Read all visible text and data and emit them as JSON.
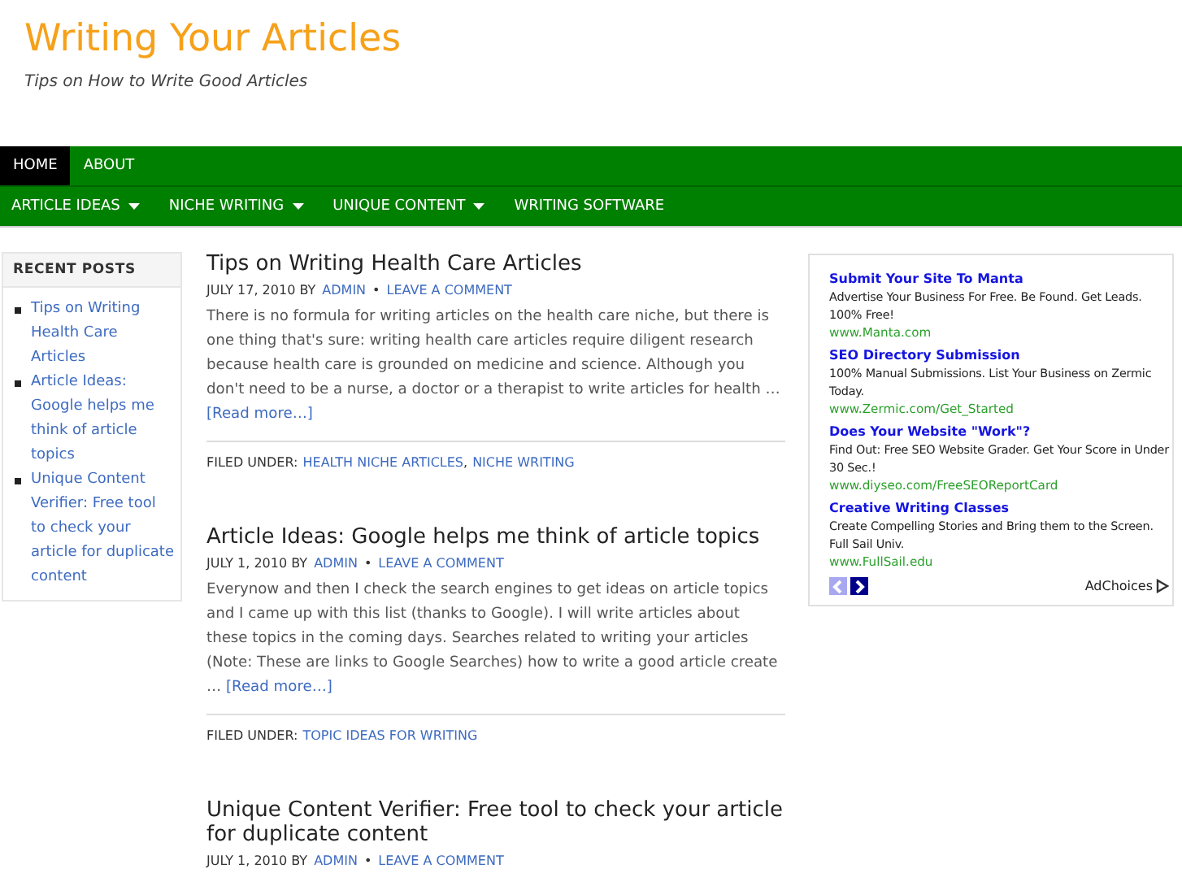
{
  "site": {
    "title": "Writing Your Articles",
    "tagline": "Tips on How to Write Good Articles"
  },
  "primary_nav": [
    {
      "label": "HOME",
      "selected": true
    },
    {
      "label": "ABOUT",
      "selected": false
    }
  ],
  "secondary_nav": [
    {
      "label": "ARTICLE IDEAS",
      "has_submenu": true
    },
    {
      "label": "NICHE WRITING",
      "has_submenu": true
    },
    {
      "label": "UNIQUE CONTENT",
      "has_submenu": true
    },
    {
      "label": "WRITING SOFTWARE",
      "has_submenu": false
    }
  ],
  "sidebar": {
    "title": "RECENT POSTS",
    "items": [
      "Tips on Writing Health Care Articles",
      "Article Ideas: Google helps me think of article topics",
      "Unique Content Verifier: Free tool to check your article for duplicate content"
    ]
  },
  "posts": [
    {
      "title": "Tips on Writing Health Care Articles",
      "date": "JULY 17, 2010 BY",
      "author": "ADMIN",
      "bullet": "•",
      "comments": "LEAVE A COMMENT",
      "excerpt": "There is no formula for writing articles on the health care niche, but there is one thing that's sure: writing health care articles require diligent research because health care is grounded on medicine and science. Although you don't need to be a nurse, a doctor or a therapist to write articles for health …",
      "read_more": "[Read more…]",
      "filed_label": "FILED UNDER:",
      "categories": [
        "HEALTH NICHE ARTICLES",
        "NICHE WRITING"
      ],
      "separator": ","
    },
    {
      "title": "Article Ideas: Google helps me think of article topics",
      "date": "JULY 1, 2010 BY",
      "author": "ADMIN",
      "bullet": "•",
      "comments": "LEAVE A COMMENT",
      "excerpt": "Everynow and then I check the search engines to get ideas on article topics and I came up with this list (thanks to Google). I will write articles about these topics in the coming days. Searches related to writing your articles (Note: These are links to Google Searches) how to write a good article create …",
      "read_more": "[Read more…]",
      "filed_label": "FILED UNDER:",
      "categories": [
        "TOPIC IDEAS FOR WRITING"
      ]
    },
    {
      "title": "Unique Content Verifier: Free tool to check your article for duplicate content",
      "date": "JULY 1, 2010 BY",
      "author": "ADMIN",
      "bullet": "•",
      "comments": "LEAVE A COMMENT"
    }
  ],
  "ads": {
    "items": [
      {
        "title": "Submit Your Site To Manta",
        "text": "Advertise Your Business For Free. Be Found. Get Leads. 100% Free!",
        "url": "www.Manta.com"
      },
      {
        "title": "SEO Directory Submission",
        "text": "100% Manual Submissions. List Your Business on Zermic Today.",
        "url": "www.Zermic.com/Get_Started"
      },
      {
        "title": "Does Your Website \"Work\"?",
        "text": "Find Out: Free SEO Website Grader. Get Your Score in Under 30 Sec.!",
        "url": "www.diyseo.com/FreeSEOReportCard"
      },
      {
        "title": "Creative Writing Classes",
        "text": "Create Compelling Stories and Bring them to the Screen. Full Sail Univ.",
        "url": "www.FullSail.edu"
      }
    ],
    "prev_disabled": true,
    "next_disabled": false,
    "adchoices": "AdChoices"
  }
}
